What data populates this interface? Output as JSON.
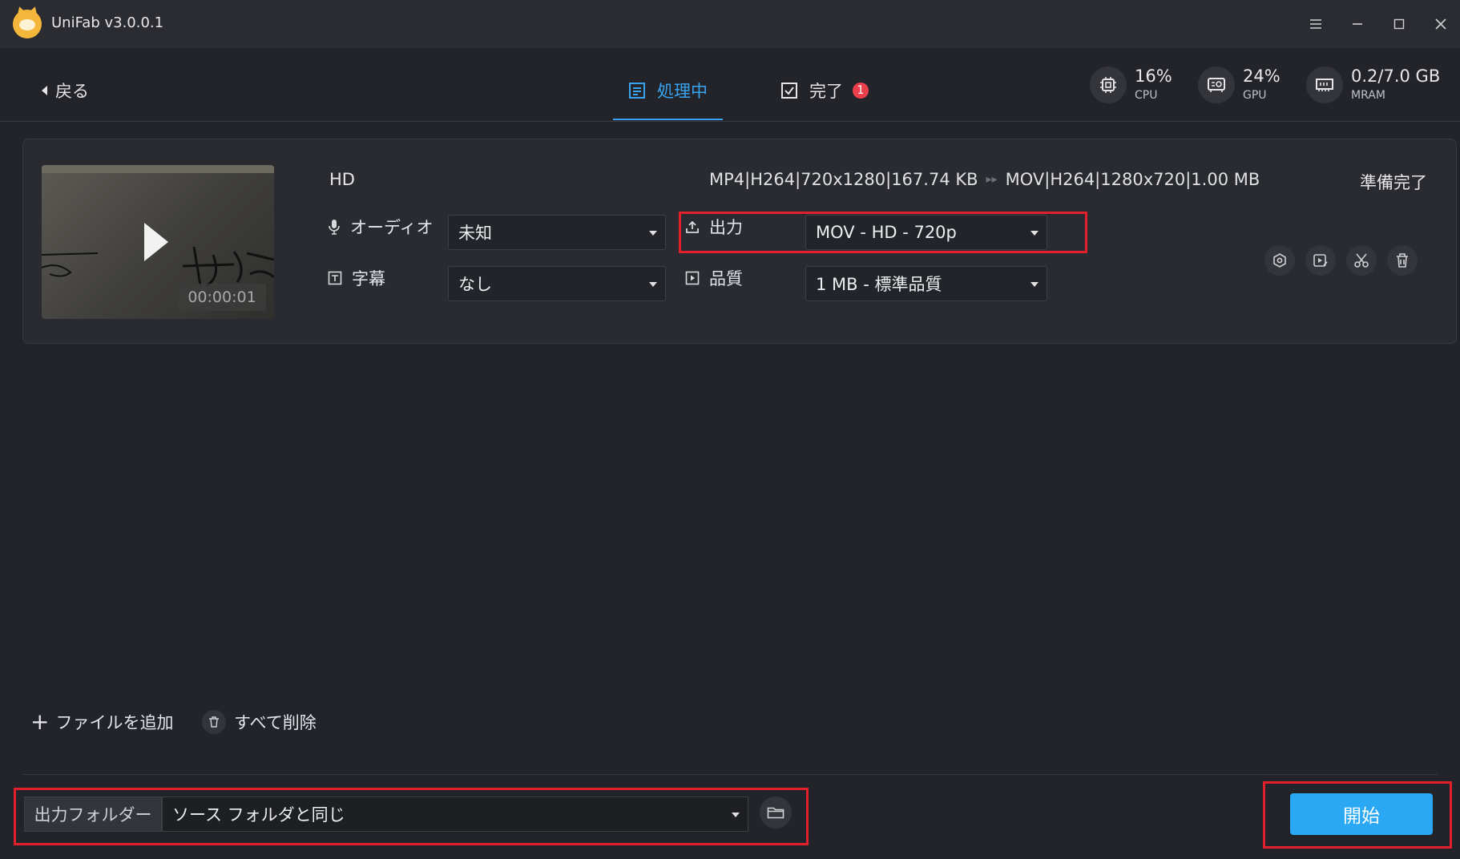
{
  "window": {
    "title": "UniFab v3.0.0.1",
    "controls": [
      "menu-icon",
      "minimize-icon",
      "maximize-icon",
      "close-icon"
    ]
  },
  "nav": {
    "back_label": "戻る",
    "tabs": [
      {
        "label": "処理中",
        "active": true,
        "icon": "list-icon"
      },
      {
        "label": "完了",
        "active": false,
        "icon": "check-square-icon",
        "badge": "1"
      }
    ]
  },
  "stats": [
    {
      "value": "16%",
      "label": "CPU",
      "icon": "cpu-icon"
    },
    {
      "value": "24%",
      "label": "GPU",
      "icon": "gpu-icon"
    },
    {
      "value": "0.2/7.0 GB",
      "label": "MRAM",
      "icon": "memory-icon"
    }
  ],
  "file": {
    "name": "HD",
    "duration": "00:00:01",
    "source_spec": "MP4|H264|720x1280|167.74 KB",
    "target_spec": "MOV|H264|1280x720|1.00 MB",
    "status": "準備完了",
    "audio": {
      "label": "オーディオ",
      "value": "未知"
    },
    "subtitle": {
      "label": "字幕",
      "value": "なし"
    },
    "output": {
      "label": "出力",
      "value": "MOV - HD - 720p"
    },
    "quality": {
      "label": "品質",
      "value": "1 MB - 標準品質"
    },
    "actions": [
      "settings-icon",
      "preview-icon",
      "cut-icon",
      "trash-icon"
    ]
  },
  "bottom": {
    "add_file": "ファイルを追加",
    "delete_all": "すべて削除",
    "output_folder_label": "出力フォルダー",
    "output_folder_value": "ソース フォルダと同じ",
    "start": "開始"
  },
  "colors": {
    "accent": "#38a3f1",
    "highlight": "#e2202b",
    "badge": "#ec3f4c",
    "start_button": "#2aa8f4"
  }
}
